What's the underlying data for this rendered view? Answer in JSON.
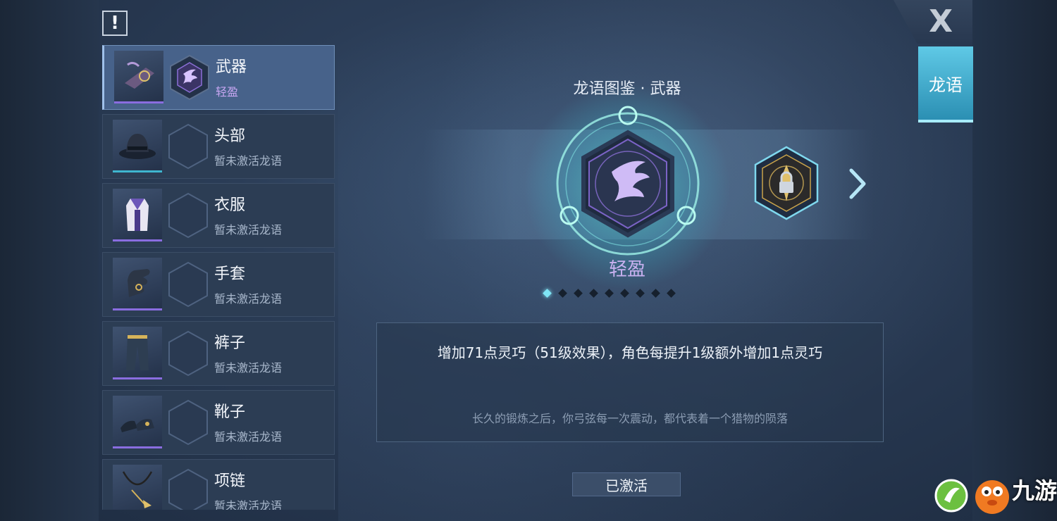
{
  "alert": {
    "glyph": "!"
  },
  "close": {
    "glyph": "X"
  },
  "side_tab": {
    "label": "龙语"
  },
  "slots": [
    {
      "name": "武器",
      "status": "轻盈",
      "active": true,
      "rarity_color": "#8a6de0",
      "icon": "weapon-icon",
      "rune": true
    },
    {
      "name": "头部",
      "status": "暂未激活龙语",
      "active": false,
      "rarity_color": "#3fb6cf",
      "icon": "hat-icon",
      "rune": false
    },
    {
      "name": "衣服",
      "status": "暂未激活龙语",
      "active": false,
      "rarity_color": "#8a6de0",
      "icon": "outfit-icon",
      "rune": false
    },
    {
      "name": "手套",
      "status": "暂未激活龙语",
      "active": false,
      "rarity_color": "#8a6de0",
      "icon": "glove-icon",
      "rune": false
    },
    {
      "name": "裤子",
      "status": "暂未激活龙语",
      "active": false,
      "rarity_color": "#8a6de0",
      "icon": "pants-icon",
      "rune": false
    },
    {
      "name": "靴子",
      "status": "暂未激活龙语",
      "active": false,
      "rarity_color": "#8a6de0",
      "icon": "boots-icon",
      "rune": false
    },
    {
      "name": "项链",
      "status": "暂未激活龙语",
      "active": false,
      "rarity_color": "#8a6de0",
      "icon": "necklace-icon",
      "rune": false
    }
  ],
  "codex": {
    "title": "龙语图鉴 · 武器",
    "rune_name": "轻盈",
    "page_count": 9,
    "current_page": 1,
    "effect": "增加71点灵巧（51级效果），角色每提升1级额外增加1点灵巧",
    "flavor": "长久的锻炼之后，你弓弦每一次震动，都代表着一个猎物的陨落",
    "activated_label": "已激活"
  },
  "watermark": {
    "text": "九游"
  }
}
